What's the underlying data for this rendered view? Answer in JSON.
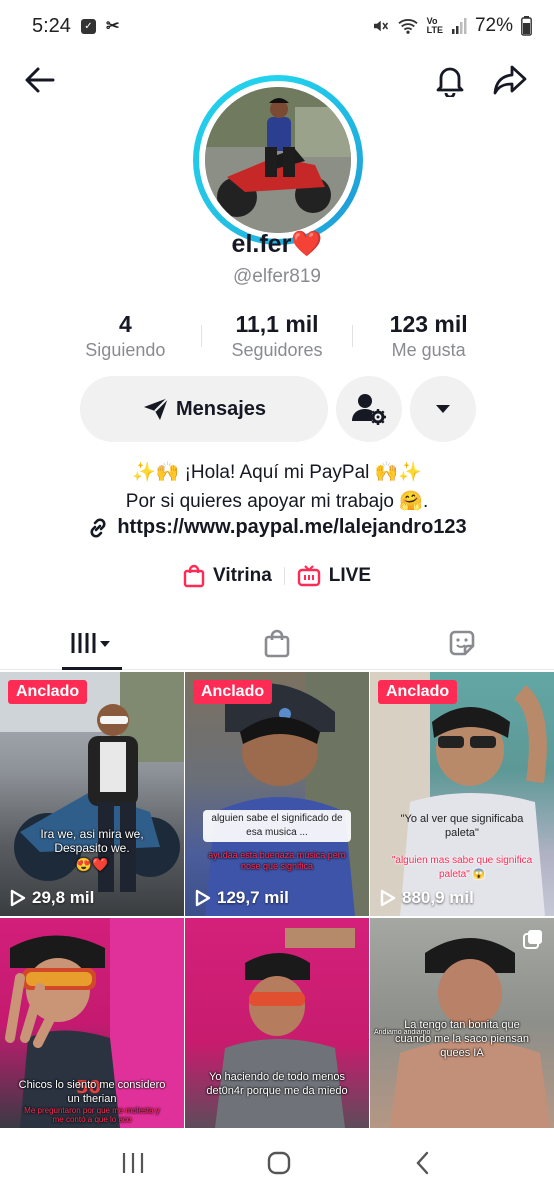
{
  "status_bar": {
    "time": "5:24",
    "battery": "72%"
  },
  "profile": {
    "display_name": "el.fer",
    "heart": "❤️",
    "username": "@elfer819"
  },
  "stats": [
    {
      "value": "4",
      "label": "Siguiendo"
    },
    {
      "value": "11,1 mil",
      "label": "Seguidores"
    },
    {
      "value": "123 mil",
      "label": "Me gusta"
    }
  ],
  "actions": {
    "message_label": "Mensajes"
  },
  "bio": {
    "line1": "✨🙌 ¡Hola! Aquí mi PayPal 🙌✨",
    "line2": "Por si quieres apoyar mi trabajo 🤗.",
    "link": "https://www.paypal.me/lalejandro123"
  },
  "shop": {
    "vitrina": "Vitrina",
    "live": "LIVE"
  },
  "videos": [
    {
      "pinned": "Anclado",
      "views": "29,8 mil",
      "caption": "Ira we, asi mira we, Despasito we.",
      "caption2": "😍❤️"
    },
    {
      "pinned": "Anclado",
      "views": "129,7 mil",
      "caption": "alguien  sabe el significado de esa musica ...",
      "caption2": "ayudaa esta buenaza música  pero nose que significa"
    },
    {
      "pinned": "Anclado",
      "views": "880,9 mil",
      "caption": "\"Yo al ver que significaba paleta\"",
      "caption2": "\"alguien  mas sabe que significa paleta\" 😱"
    },
    {
      "caption": "Chicos lo siento me considero un therian",
      "caption2": "Me preguntaron por que me molesta y me contó a que lo aco"
    },
    {
      "caption": "Yo haciendo de todo menos det0n4r porque me da miedo"
    },
    {
      "caption": "La tengo tan bonita que cuando me la saco piensan quees IA",
      "caption_small": "Andiamo andiamo"
    }
  ]
}
